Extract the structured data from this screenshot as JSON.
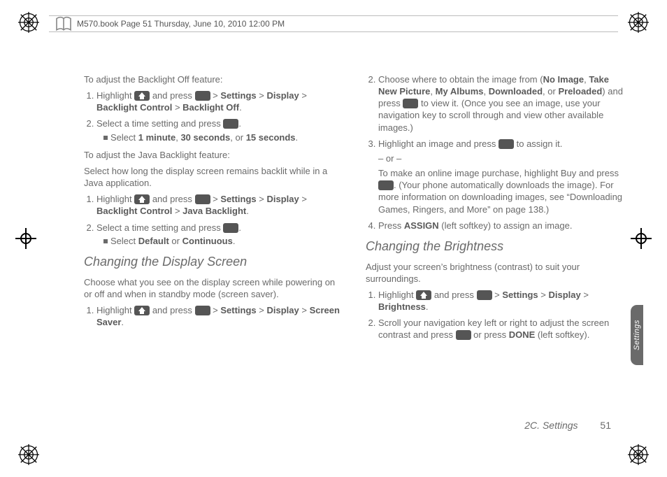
{
  "header_text": "M570.book  Page 51  Thursday, June 10, 2010  12:00 PM",
  "left": {
    "intro1": "To adjust the Backlight Off feature:",
    "s1_prefix": "Highlight ",
    "s1_mid": " and press ",
    "s1_trail": " > ",
    "nav_settings": "Settings",
    "nav_display": "Display",
    "nav_backlight_ctrl": "Backlight Control",
    "nav_backlight_off": "Backlight Off",
    "s2_prefix": "Select a time setting and press ",
    "s2_suffix": ".",
    "s2_sub_pre": "Select ",
    "opt_1min": "1 minute",
    "opt_30s": "30 seconds",
    "opt_or": ", or ",
    "opt_15s": "15 seconds",
    "intro2": "To adjust the Java Backlight feature:",
    "para2": "Select how long the display screen remains backlit while in a Java application.",
    "nav_java": "Java Backlight",
    "sub2_pre": "Select ",
    "opt_default": "Default",
    "txt_or": " or ",
    "opt_cont": "Continuous",
    "head1": "Changing the Display Screen",
    "para3": "Choose what you see on the display screen while powering on or off and when in standby mode (screen saver).",
    "nav_screensaver": "Screen Saver"
  },
  "right": {
    "s2_pre": "Choose where to obtain the image from (",
    "opt_noimg": "No Image",
    "opt_take": "Take New Picture",
    "opt_albums": "My Albums",
    "opt_down": "Downloaded",
    "opt_pre": "Preloaded",
    "s2_mid": ") and press ",
    "s2_post": " to view it. (Once you see an image, use your navigation key to scroll through and view other available images.)",
    "s3_pre": "Highlight an image and press ",
    "s3_post": " to assign it.",
    "or": "– or –",
    "s3b_pre": "To make an online image purchase, highlight Buy and press ",
    "s3b_post": ". (Your phone automatically downloads the image). For more information on downloading images, see “Downloading Games, Ringers, and More” on page 138.)",
    "s4_pre": "Press ",
    "s4_assign": "ASSIGN",
    "s4_post": " (left softkey) to assign an image.",
    "head2": "Changing the Brightness",
    "para4": "Adjust your screen’s brightness (contrast) to suit your surroundings.",
    "nav_bright": "Brightness",
    "s2b_pre": "Scroll your navigation key left or right to adjust the screen contrast and press ",
    "s2b_mid": " or press ",
    "s2b_done": "DONE",
    "s2b_post": " (left softkey)."
  },
  "tab_label": "Settings",
  "footer_section": "2C. Settings",
  "footer_page": "51",
  "sep_comma": ", "
}
